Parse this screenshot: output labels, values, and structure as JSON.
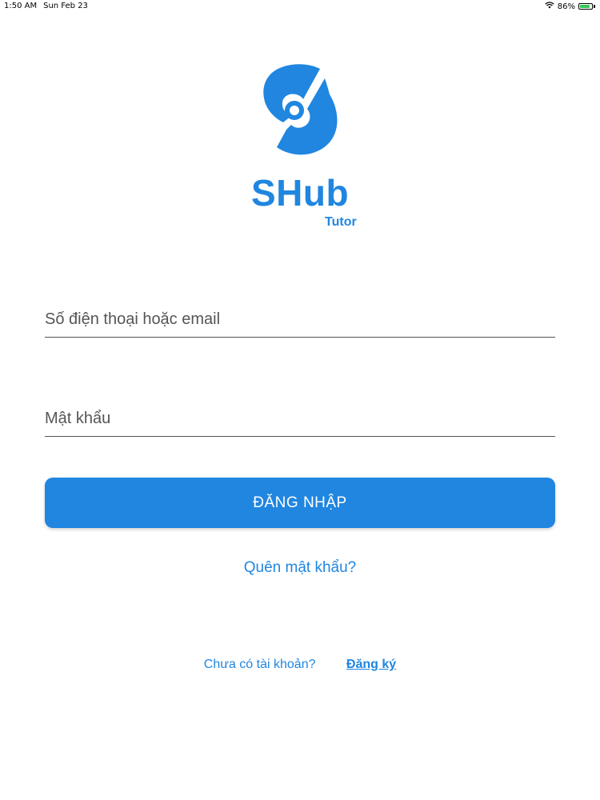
{
  "status_bar": {
    "time": "1:50 AM",
    "date": "Sun Feb 23",
    "battery_percent": "86%",
    "battery_level": 0.86,
    "wifi_icon": "wifi-icon",
    "battery_icon": "battery-charging-icon"
  },
  "brand": {
    "logo_icon": "shub-logo-icon",
    "name": "SHub",
    "sub": "Tutor",
    "color": "#2086e0"
  },
  "form": {
    "phone_placeholder": "Số điện thoại hoặc email",
    "password_placeholder": "Mật khẩu",
    "login_label": "ĐĂNG NHẬP",
    "forgot_label": "Quên mật khẩu?",
    "signup_prompt": "Chưa có tài khoản?",
    "signup_label": "Đăng ký"
  }
}
